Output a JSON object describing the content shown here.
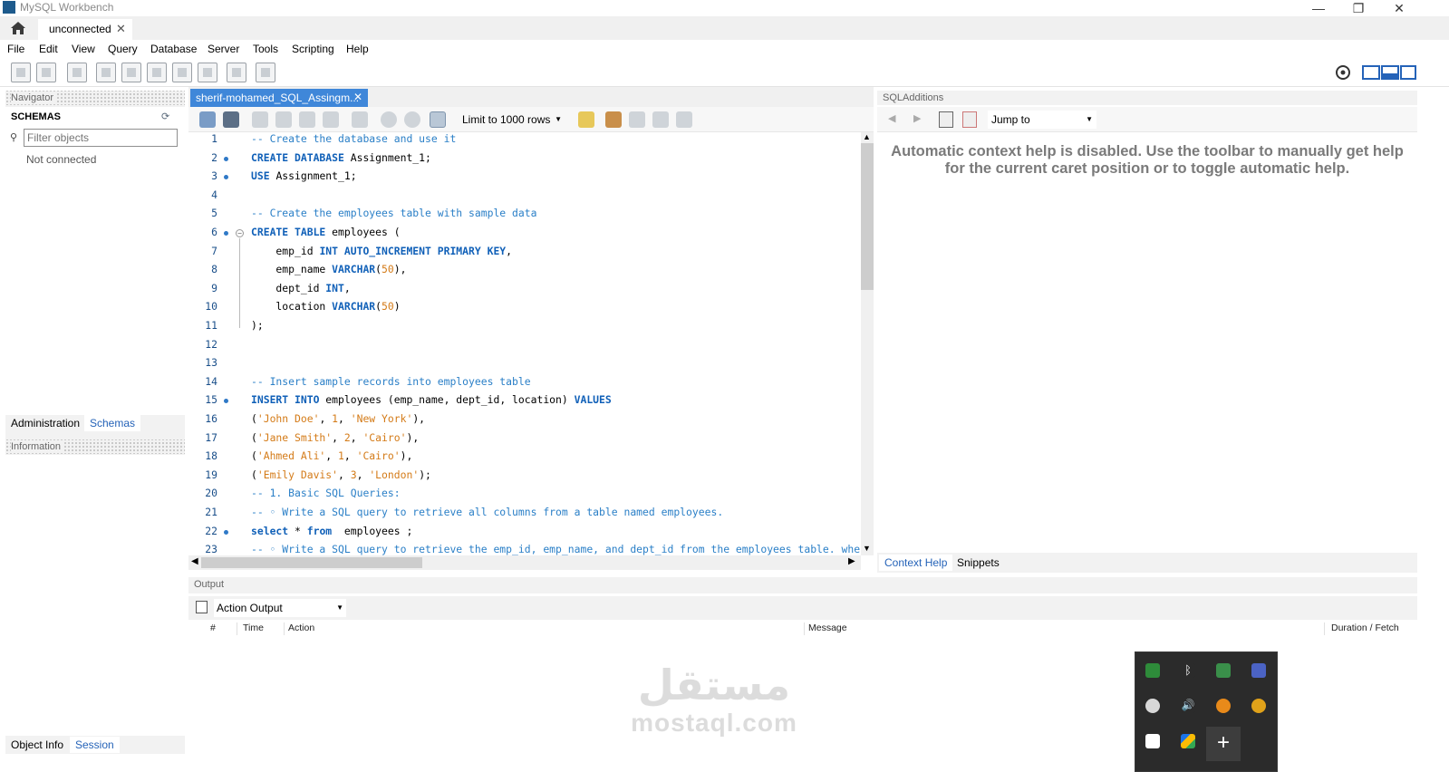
{
  "window": {
    "title": "MySQL Workbench",
    "min": "—",
    "max": "❐",
    "close": "✕"
  },
  "tabs": {
    "connection": "unconnected",
    "close": "✕"
  },
  "menu": [
    "File",
    "Edit",
    "View",
    "Query",
    "Database",
    "Server",
    "Tools",
    "Scripting",
    "Help"
  ],
  "navigator": {
    "header": "Navigator",
    "schemas_label": "SCHEMAS",
    "filter_placeholder": "Filter objects",
    "status": "Not connected",
    "tabs": [
      "Administration",
      "Schemas"
    ],
    "info_header": "Information",
    "bottom_tabs": [
      "Object Info",
      "Session"
    ]
  },
  "editor": {
    "tab_title": "sherif-mohamed_SQL_Assingm...",
    "limit": "Limit to 1000 rows",
    "lines": [
      {
        "n": "1",
        "dot": false,
        "fold": "",
        "parts": [
          {
            "c": "cm",
            "t": "-- Create the database and use it"
          }
        ]
      },
      {
        "n": "2",
        "dot": true,
        "fold": "",
        "parts": [
          {
            "c": "kw",
            "t": "CREATE DATABASE "
          },
          {
            "c": "id",
            "t": "Assignment_1;"
          }
        ]
      },
      {
        "n": "3",
        "dot": true,
        "fold": "",
        "parts": [
          {
            "c": "kw",
            "t": "USE "
          },
          {
            "c": "id",
            "t": "Assignment_1;"
          }
        ]
      },
      {
        "n": "4",
        "dot": false,
        "fold": "",
        "parts": []
      },
      {
        "n": "5",
        "dot": false,
        "fold": "",
        "parts": [
          {
            "c": "cm",
            "t": "-- Create the employees table with sample data"
          }
        ]
      },
      {
        "n": "6",
        "dot": true,
        "fold": "⊖",
        "parts": [
          {
            "c": "kw",
            "t": "CREATE TABLE "
          },
          {
            "c": "id",
            "t": "employees ("
          }
        ]
      },
      {
        "n": "7",
        "dot": false,
        "fold": "",
        "parts": [
          {
            "c": "id",
            "t": "    emp_id "
          },
          {
            "c": "kw",
            "t": "INT AUTO_INCREMENT PRIMARY KEY"
          },
          {
            "c": "id",
            "t": ","
          }
        ]
      },
      {
        "n": "8",
        "dot": false,
        "fold": "",
        "parts": [
          {
            "c": "id",
            "t": "    emp_name "
          },
          {
            "c": "kw",
            "t": "VARCHAR"
          },
          {
            "c": "id",
            "t": "("
          },
          {
            "c": "nm",
            "t": "50"
          },
          {
            "c": "id",
            "t": "),"
          }
        ]
      },
      {
        "n": "9",
        "dot": false,
        "fold": "",
        "parts": [
          {
            "c": "id",
            "t": "    dept_id "
          },
          {
            "c": "kw",
            "t": "INT"
          },
          {
            "c": "id",
            "t": ","
          }
        ]
      },
      {
        "n": "10",
        "dot": false,
        "fold": "",
        "parts": [
          {
            "c": "id",
            "t": "    location "
          },
          {
            "c": "kw",
            "t": "VARCHAR"
          },
          {
            "c": "id",
            "t": "("
          },
          {
            "c": "nm",
            "t": "50"
          },
          {
            "c": "id",
            "t": ")"
          }
        ]
      },
      {
        "n": "11",
        "dot": false,
        "fold": "",
        "parts": [
          {
            "c": "id",
            "t": ");"
          }
        ]
      },
      {
        "n": "12",
        "dot": false,
        "fold": "",
        "parts": []
      },
      {
        "n": "13",
        "dot": false,
        "fold": "",
        "parts": []
      },
      {
        "n": "14",
        "dot": false,
        "fold": "",
        "parts": [
          {
            "c": "cm",
            "t": "-- Insert sample records into employees table"
          }
        ]
      },
      {
        "n": "15",
        "dot": true,
        "fold": "",
        "parts": [
          {
            "c": "kw",
            "t": "INSERT INTO "
          },
          {
            "c": "id",
            "t": "employees (emp_name, dept_id, location) "
          },
          {
            "c": "kw",
            "t": "VALUES"
          }
        ]
      },
      {
        "n": "16",
        "dot": false,
        "fold": "",
        "parts": [
          {
            "c": "id",
            "t": "("
          },
          {
            "c": "st",
            "t": "'John Doe'"
          },
          {
            "c": "id",
            "t": ", "
          },
          {
            "c": "nm",
            "t": "1"
          },
          {
            "c": "id",
            "t": ", "
          },
          {
            "c": "st",
            "t": "'New York'"
          },
          {
            "c": "id",
            "t": "),"
          }
        ]
      },
      {
        "n": "17",
        "dot": false,
        "fold": "",
        "parts": [
          {
            "c": "id",
            "t": "("
          },
          {
            "c": "st",
            "t": "'Jane Smith'"
          },
          {
            "c": "id",
            "t": ", "
          },
          {
            "c": "nm",
            "t": "2"
          },
          {
            "c": "id",
            "t": ", "
          },
          {
            "c": "st",
            "t": "'Cairo'"
          },
          {
            "c": "id",
            "t": "),"
          }
        ]
      },
      {
        "n": "18",
        "dot": false,
        "fold": "",
        "parts": [
          {
            "c": "id",
            "t": "("
          },
          {
            "c": "st",
            "t": "'Ahmed Ali'"
          },
          {
            "c": "id",
            "t": ", "
          },
          {
            "c": "nm",
            "t": "1"
          },
          {
            "c": "id",
            "t": ", "
          },
          {
            "c": "st",
            "t": "'Cairo'"
          },
          {
            "c": "id",
            "t": "),"
          }
        ]
      },
      {
        "n": "19",
        "dot": false,
        "fold": "",
        "parts": [
          {
            "c": "id",
            "t": "("
          },
          {
            "c": "st",
            "t": "'Emily Davis'"
          },
          {
            "c": "id",
            "t": ", "
          },
          {
            "c": "nm",
            "t": "3"
          },
          {
            "c": "id",
            "t": ", "
          },
          {
            "c": "st",
            "t": "'London'"
          },
          {
            "c": "id",
            "t": ");"
          }
        ]
      },
      {
        "n": "20",
        "dot": false,
        "fold": "",
        "parts": [
          {
            "c": "cm",
            "t": "-- 1. Basic SQL Queries:"
          }
        ]
      },
      {
        "n": "21",
        "dot": false,
        "fold": "",
        "parts": [
          {
            "c": "cm",
            "t": "-- ◦ Write a SQL query to retrieve all columns from a table named employees."
          }
        ]
      },
      {
        "n": "22",
        "dot": true,
        "fold": "",
        "parts": [
          {
            "c": "kw",
            "t": "select "
          },
          {
            "c": "id",
            "t": "* "
          },
          {
            "c": "kw",
            "t": "from "
          },
          {
            "c": "id",
            "t": " employees ;"
          }
        ]
      },
      {
        "n": "23",
        "dot": false,
        "fold": "",
        "parts": [
          {
            "c": "cm",
            "t": "-- ◦ Write a SQL query to retrieve the emp_id, emp_name, and dept_id from the employees table. whe"
          }
        ]
      }
    ]
  },
  "sql_additions": {
    "header": "SQLAdditions",
    "jump_to": "Jump to",
    "help_text": "Automatic context help is disabled. Use the toolbar to manually get help for the current caret position or to toggle automatic help.",
    "tabs": [
      "Context Help",
      "Snippets"
    ]
  },
  "output": {
    "header": "Output",
    "selector": "Action Output",
    "columns": [
      "#",
      "Time",
      "Action",
      "Message",
      "Duration / Fetch"
    ]
  },
  "watermark": {
    "arabic": "مستقل",
    "latin": "mostaql.com"
  },
  "tray": {
    "plus": "+"
  },
  "colors": {
    "accent": "#3f87d9",
    "keyword": "#1060b8",
    "comment": "#2a7fc7",
    "string": "#d47b18"
  }
}
